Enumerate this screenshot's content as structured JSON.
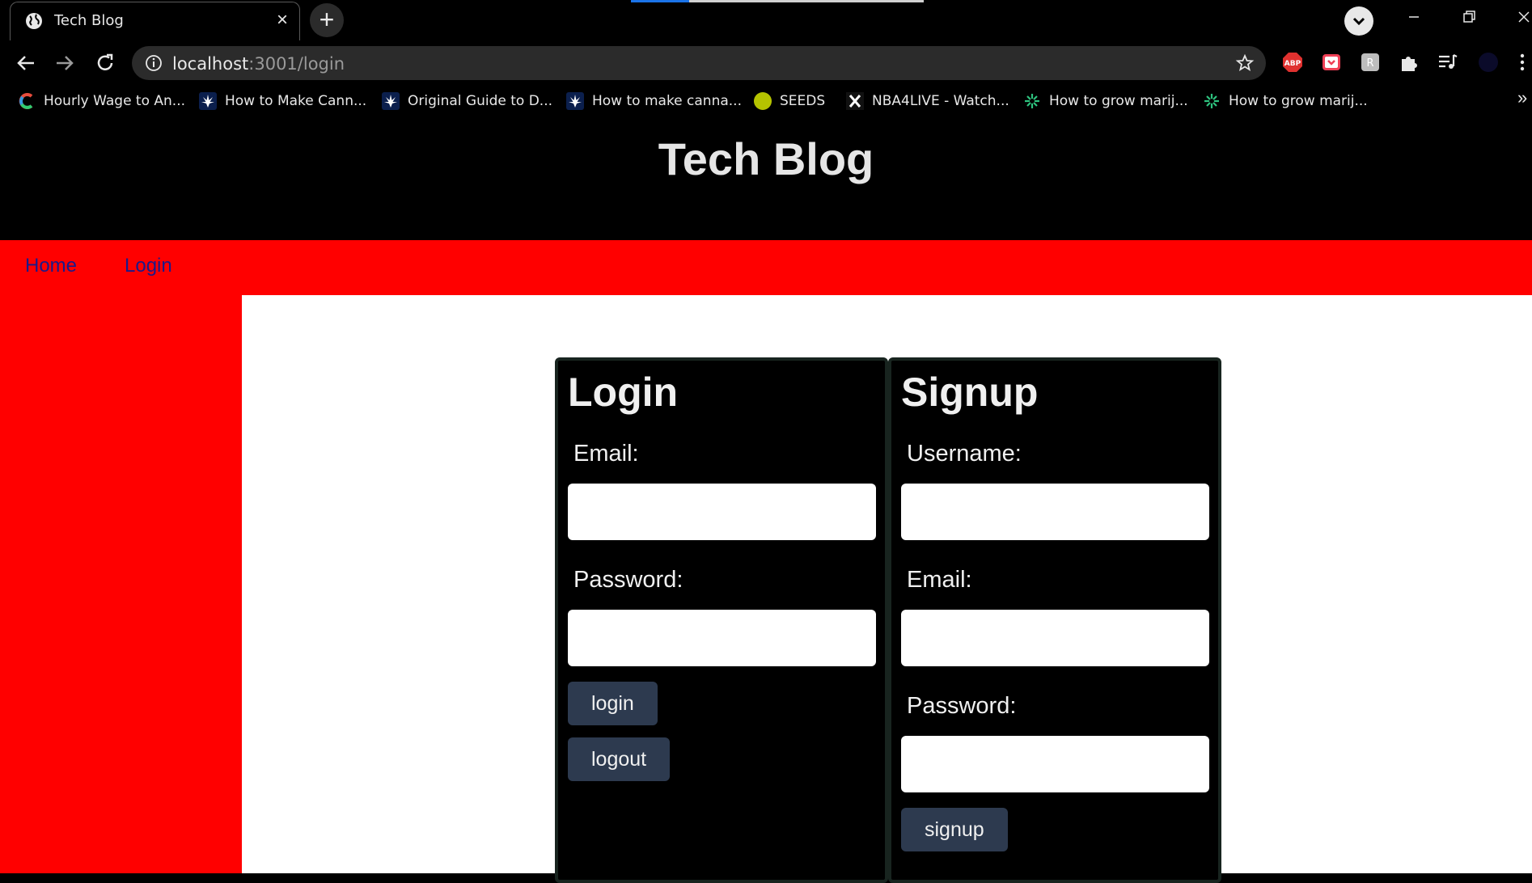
{
  "browser": {
    "tab": {
      "title": "Tech Blog"
    },
    "url": {
      "host": "localhost",
      "path": ":3001/login"
    },
    "bookmarks": [
      {
        "label": "Hourly Wage to An...",
        "icon": "rainbow-c-icon"
      },
      {
        "label": "How to Make Cann...",
        "icon": "cannabis-leaf-icon"
      },
      {
        "label": "Original Guide to D...",
        "icon": "cannabis-leaf-icon"
      },
      {
        "label": "How to make canna...",
        "icon": "cannabis-leaf-icon"
      },
      {
        "label": "SEEDS",
        "icon": "seeds-logo-icon"
      },
      {
        "label": "NBA4LIVE - Watch...",
        "icon": "x-logo-icon"
      },
      {
        "label": "How to grow marij...",
        "icon": "green-sparkle-icon"
      },
      {
        "label": "How to grow marij...",
        "icon": "green-sparkle-icon"
      }
    ],
    "bookmarks_more": "»",
    "extensions": [
      "abp-icon",
      "pocket-icon",
      "translate-icon",
      "puzzle-icon",
      "media-control-icon",
      "profile-avatar-icon",
      "kebab-menu-icon"
    ]
  },
  "site": {
    "title": "Tech Blog",
    "nav": [
      {
        "label": "Home"
      },
      {
        "label": "Login"
      }
    ]
  },
  "login_card": {
    "title": "Login",
    "email_label": "Email:",
    "password_label": "Password:",
    "login_button": "login",
    "logout_button": "logout"
  },
  "signup_card": {
    "title": "Signup",
    "username_label": "Username:",
    "email_label": "Email:",
    "password_label": "Password:",
    "signup_button": "signup"
  },
  "colors": {
    "nav_red": "#ff0000",
    "header_black": "#000000",
    "button_slate": "#2d3a4f",
    "card_border": "#18241f"
  }
}
